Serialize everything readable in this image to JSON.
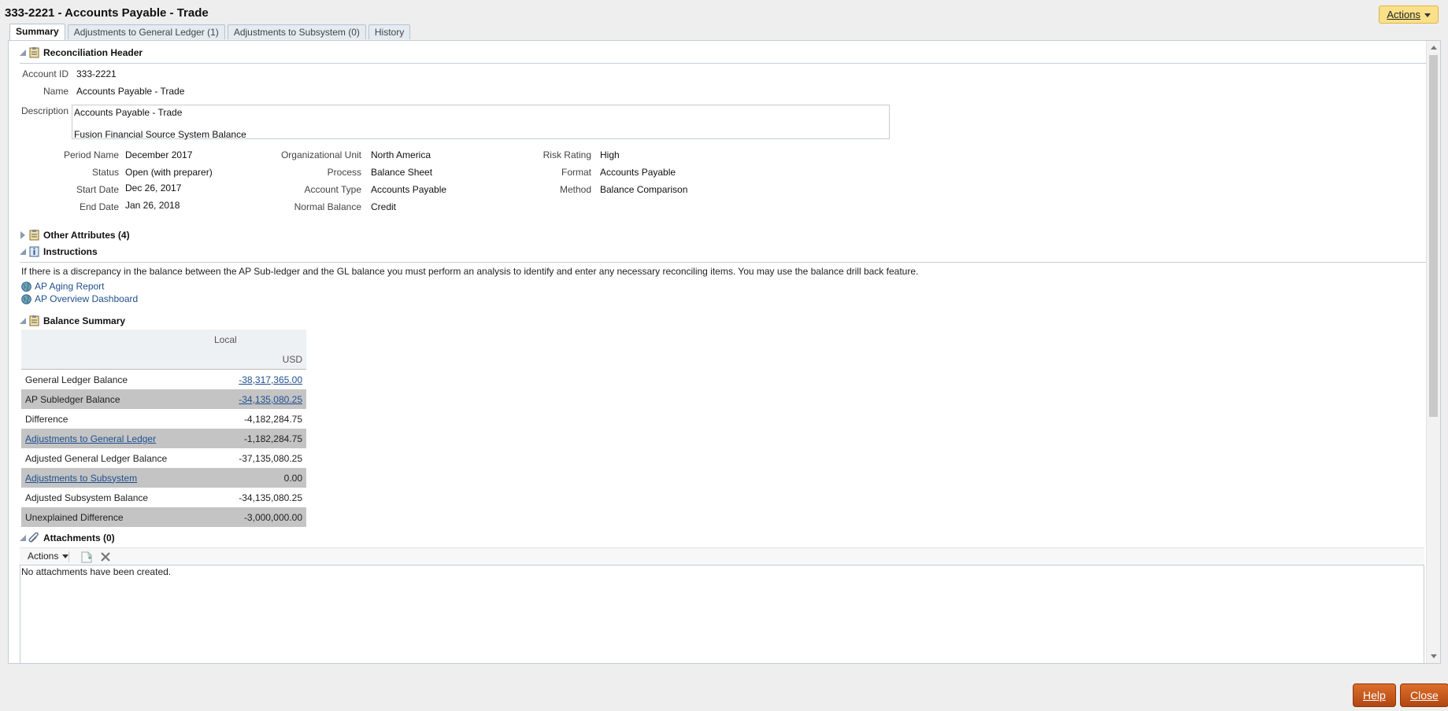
{
  "window": {
    "title": "333-2221 - Accounts Payable - Trade",
    "actions_label": "Actions"
  },
  "tabs": [
    {
      "label": "Summary",
      "active": true
    },
    {
      "label": "Adjustments to General Ledger (1)",
      "active": false
    },
    {
      "label": "Adjustments to Subsystem (0)",
      "active": false
    },
    {
      "label": "History",
      "active": false
    }
  ],
  "reconciliation_header": {
    "title": "Reconciliation Header",
    "account_id_label": "Account ID",
    "account_id": "333-2221",
    "name_label": "Name",
    "name": "Accounts Payable - Trade",
    "description_label": "Description",
    "description_line1": "Accounts Payable - Trade",
    "description_line2": "Fusion Financial Source System Balance",
    "fields": {
      "period_name_label": "Period Name",
      "period_name": "December 2017",
      "status_label": "Status",
      "status": "Open (with preparer)",
      "start_date_label": "Start Date",
      "start_date": "Dec 26, 2017",
      "end_date_label": "End Date",
      "end_date": "Jan 26, 2018",
      "org_unit_label": "Organizational Unit",
      "org_unit": "North America",
      "process_label": "Process",
      "process": "Balance Sheet",
      "account_type_label": "Account Type",
      "account_type": "Accounts Payable",
      "normal_balance_label": "Normal Balance",
      "normal_balance": "Credit",
      "risk_rating_label": "Risk Rating",
      "risk_rating": "High",
      "format_label": "Format",
      "format": "Accounts Payable",
      "method_label": "Method",
      "method": "Balance Comparison"
    }
  },
  "other_attributes": {
    "title": "Other Attributes (4)"
  },
  "instructions": {
    "title": "Instructions",
    "text": "If there is a discrepancy in the balance between the AP Sub-ledger and the GL balance you must perform an analysis to identify and enter any necessary reconciling items. You may use the balance drill back feature.",
    "links": [
      "AP Aging Report",
      "AP Overview Dashboard"
    ]
  },
  "balance_summary": {
    "title": "Balance Summary",
    "header_group": "Local",
    "currency": "USD",
    "rows": [
      {
        "label": "General Ledger Balance",
        "value": "-38,317,365.00"
      },
      {
        "label": "AP Subledger Balance",
        "value": "-34,135,080.25"
      },
      {
        "label": "Difference",
        "value": "-4,182,284.75"
      },
      {
        "label": "Adjustments to General Ledger",
        "value": "-1,182,284.75"
      },
      {
        "label": "Adjusted General Ledger Balance",
        "value": "-37,135,080.25"
      },
      {
        "label": "Adjustments to Subsystem",
        "value": "0.00"
      },
      {
        "label": "Adjusted Subsystem Balance",
        "value": "-34,135,080.25"
      },
      {
        "label": "Unexplained Difference",
        "value": "-3,000,000.00"
      }
    ]
  },
  "attachments": {
    "title": "Attachments (0)",
    "actions_label": "Actions",
    "empty_text": "No attachments have been created."
  },
  "footer": {
    "help_label": "Help",
    "close_label": "Close"
  },
  "colors": {
    "accent_button": "#c4581b",
    "actions_button": "#fbe08a",
    "link": "#1f4f8f"
  }
}
